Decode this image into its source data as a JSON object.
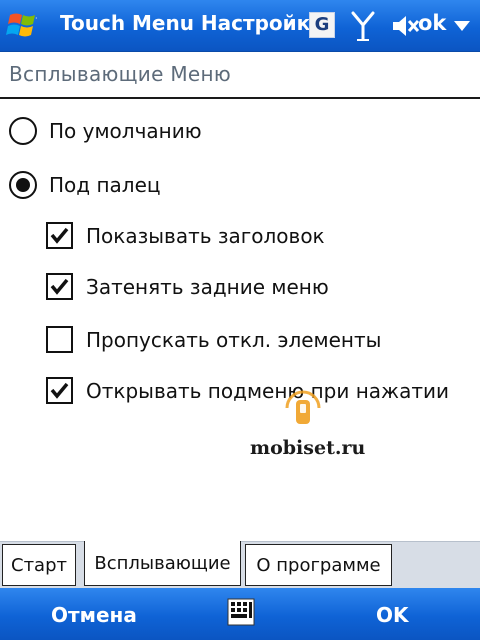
{
  "titlebar": {
    "title": "Touch Menu Настройк",
    "g_label": "G",
    "ok_label": "ok",
    "icons": [
      "windows-start-icon",
      "signal-icon",
      "volume-mute-icon",
      "chevron-down-icon"
    ]
  },
  "section": {
    "title": "Всплывающие Меню"
  },
  "radios": [
    {
      "label": "По умолчанию",
      "selected": false
    },
    {
      "label": "Под палец",
      "selected": true
    }
  ],
  "checkboxes": [
    {
      "label": "Показывать заголовок",
      "checked": true
    },
    {
      "label": "Затенять задние меню",
      "checked": true
    },
    {
      "label": "Пропускать откл. элементы",
      "checked": false
    },
    {
      "label": "Открывать подменю при нажатии",
      "checked": true
    }
  ],
  "watermark": {
    "text": "mobiset.ru"
  },
  "tabs": [
    {
      "label": "Старт",
      "active": false
    },
    {
      "label": "Всплывающие",
      "active": true
    },
    {
      "label": "О программе",
      "active": false
    }
  ],
  "softkeys": {
    "left": "Отмена",
    "right": "OK"
  },
  "colors": {
    "bar_blue": "#0f63d6",
    "tab_strip": "#d7dde6",
    "section_text": "#5d6b7a",
    "watermark_orange": "#f0a020"
  }
}
